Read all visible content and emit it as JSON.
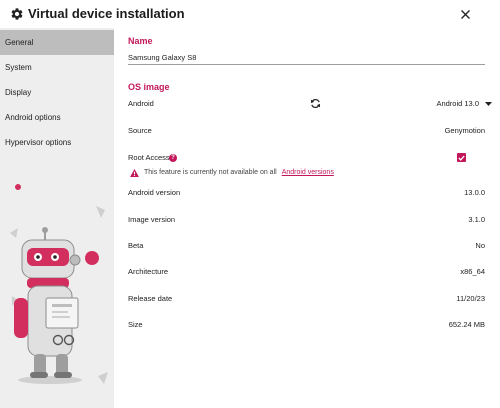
{
  "window": {
    "title": "Virtual device installation",
    "settings_icon": "gear-icon",
    "close_icon": "close-icon"
  },
  "sidebar": {
    "items": [
      {
        "label": "General",
        "active": true
      },
      {
        "label": "System",
        "active": false
      },
      {
        "label": "Display",
        "active": false
      },
      {
        "label": "Android options",
        "active": false
      },
      {
        "label": "Hypervisor options",
        "active": false
      }
    ],
    "illustration": "robot-mascot-illustration"
  },
  "name_section": {
    "title": "Name",
    "value": "Samsung Galaxy S8",
    "placeholder": ""
  },
  "os_image": {
    "title": "OS image",
    "android_label": "Android",
    "refresh_icon": "refresh-icon",
    "android_selected": "Android 13.0",
    "dropdown_icon": "caret-down-icon",
    "source_label": "Source",
    "source_value": "Genymotion",
    "root_access_label": "Root Access",
    "root_access_checked": true,
    "help_icon": "help-icon",
    "warning_text": "This feature is currently not available on all",
    "warning_link": "Android versions",
    "warning_icon": "warning-icon",
    "details": [
      {
        "label": "Android version",
        "value": "13.0.0"
      },
      {
        "label": "Image version",
        "value": "3.1.0"
      },
      {
        "label": "Beta",
        "value": "No"
      },
      {
        "label": "Architecture",
        "value": "x86_64"
      },
      {
        "label": "Release date",
        "value": "11/20/23"
      },
      {
        "label": "Size",
        "value": "652.24 MB"
      }
    ]
  },
  "colors": {
    "accent": "#c2185b",
    "sidebar_bg": "#eeeeee",
    "sidebar_active": "#bdbdbd",
    "mascot_body": "#e0e0e0",
    "mascot_accent": "#d32f5e"
  }
}
